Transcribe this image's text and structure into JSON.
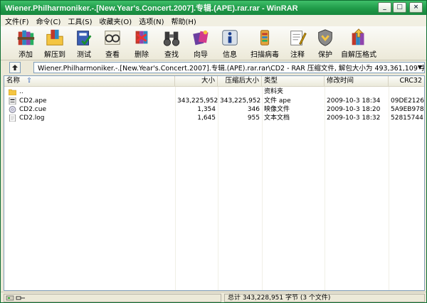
{
  "window": {
    "title": "Wiener.Philharmoniker.-.[New.Year's.Concert.2007].专辑.(APE).rar.rar - WinRAR"
  },
  "menu": [
    "文件(F)",
    "命令(C)",
    "工具(S)",
    "收藏夹(O)",
    "选项(N)",
    "帮助(H)"
  ],
  "toolbar": {
    "add": "添加",
    "extract_to": "解压到",
    "test": "测试",
    "view": "查看",
    "delete": "删除",
    "find": "查找",
    "wizard": "向导",
    "info": "信息",
    "virus_scan": "扫描病毒",
    "comment": "注释",
    "protect": "保护",
    "sfx": "自解压格式"
  },
  "address": {
    "path": "Wiener.Philharmoniker.-.[New.Year's.Concert.2007].专辑.(APE).rar.rar\\CD2 - RAR 压缩文件, 解包大小为 493,361,109 字节"
  },
  "columns": {
    "name": "名称",
    "size": "大小",
    "packed": "压缩后大小",
    "type": "类型",
    "modified": "修改时间",
    "crc": "CRC32"
  },
  "files": [
    {
      "name": "..",
      "size": "",
      "packed": "",
      "type": "资料夹",
      "modified": "",
      "crc": "",
      "icon": "folder-icon"
    },
    {
      "name": "CD2.ape",
      "size": "343,225,952",
      "packed": "343,225,952",
      "type": "文件 ape",
      "modified": "2009-10-3 18:34",
      "crc": "09DE2126",
      "icon": "ape-file-icon"
    },
    {
      "name": "CD2.cue",
      "size": "1,354",
      "packed": "346",
      "type": "映像文件",
      "modified": "2009-10-3 18:20",
      "crc": "5A9EB978",
      "icon": "disc-image-icon"
    },
    {
      "name": "CD2.log",
      "size": "1,645",
      "packed": "955",
      "type": "文本文档",
      "modified": "2009-10-3 18:32",
      "crc": "52815744",
      "icon": "text-file-icon"
    }
  ],
  "status": {
    "total": "总计 343,228,951 字节 (3 个文件)"
  },
  "colors": {
    "titlebar": "#1f9a48",
    "desktop": "#1b9c46",
    "chrome": "#ece9d8"
  }
}
